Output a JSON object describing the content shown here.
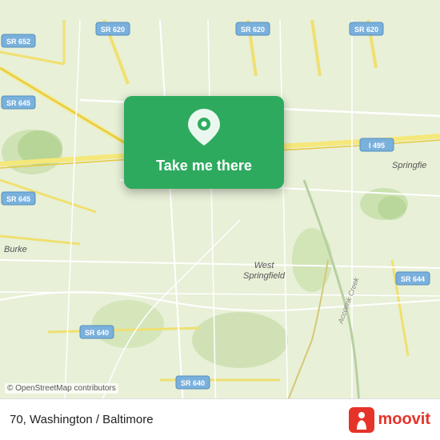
{
  "map": {
    "background_color": "#e8f0d8",
    "center_lat": 38.78,
    "center_lon": -77.18
  },
  "card": {
    "label": "Take me there",
    "background_color": "#2eaa5f",
    "pin_icon": "location-pin"
  },
  "bottom_bar": {
    "location_label": "70, Washington / Baltimore",
    "attribution_text": "© OpenStreetMap contributors",
    "logo_text": "moovit"
  },
  "road_labels": [
    "SR 652",
    "SR 620",
    "SR 620",
    "SR 620",
    "SR 645",
    "I 495",
    "SR 645",
    "Springfield",
    "Burke",
    "SR 644",
    "West Springfield",
    "SR 640",
    "SR 640",
    "Accotink Creek"
  ]
}
